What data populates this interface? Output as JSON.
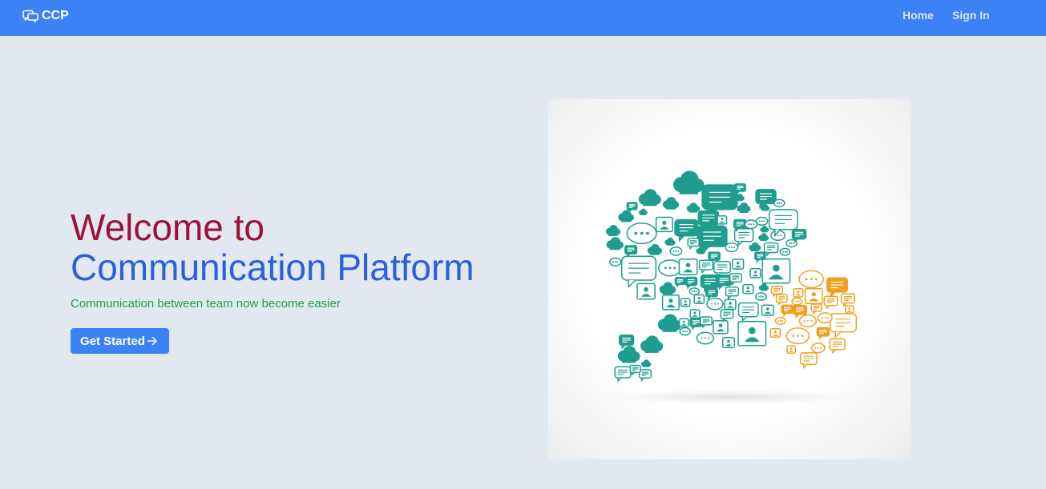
{
  "navbar": {
    "brand": {
      "icon": "chat-bubbles-icon",
      "label": "CCP"
    },
    "links": [
      {
        "label": "Home"
      },
      {
        "label": "Sign In"
      }
    ],
    "colors": {
      "background": "#3b82f6",
      "link": "#dbe7fb"
    }
  },
  "hero": {
    "title_line1": "Welcome to",
    "title_line2": "Communication Platform",
    "subtitle": "Communication between team now become easier",
    "cta": {
      "label": "Get Started",
      "icon": "arrow-right-icon"
    },
    "colors": {
      "title_line1": "#9d1238",
      "title_line2": "#2d5fdc",
      "subtitle": "#16a34a",
      "cta": "#3b82f6",
      "background": "#e2e8f0"
    },
    "illustration": {
      "icon": "speech-bubble-cloud-illustration",
      "colors": {
        "teal": "#1f9e8f",
        "orange": "#f0a020"
      }
    }
  }
}
